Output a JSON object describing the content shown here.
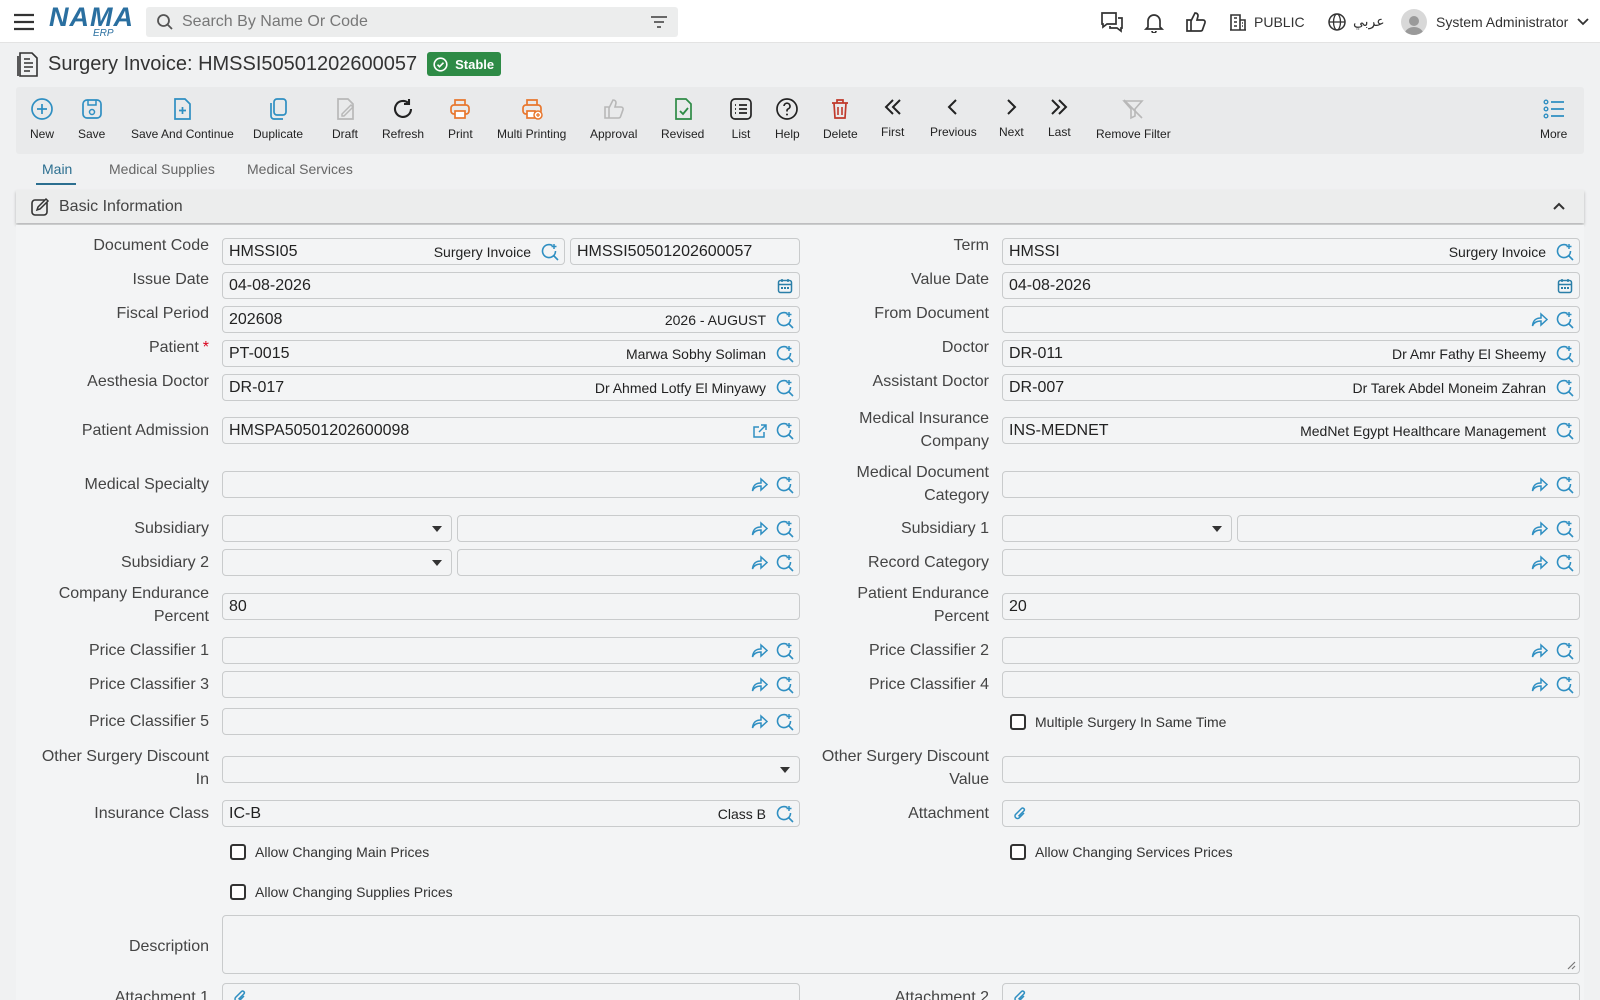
{
  "topbar": {
    "logo_main": "NAMA",
    "logo_sub": "ERP",
    "search_placeholder": "Search By Name Or Code",
    "company": "PUBLIC",
    "language": "عربي",
    "user": "System Administrator"
  },
  "page": {
    "title": "Surgery Invoice: HMSSI50501202600057",
    "status": "Stable"
  },
  "toolbar": {
    "new": "New",
    "save": "Save",
    "save_continue": "Save And Continue",
    "duplicate": "Duplicate",
    "draft": "Draft",
    "refresh": "Refresh",
    "print": "Print",
    "multi_printing": "Multi Printing",
    "approval": "Approval",
    "revised": "Revised",
    "list": "List",
    "help": "Help",
    "delete": "Delete",
    "first": "First",
    "previous": "Previous",
    "next": "Next",
    "last": "Last",
    "remove_filter": "Remove Filter",
    "more": "More"
  },
  "tabs": [
    "Main",
    "Medical Supplies",
    "Medical Services"
  ],
  "section": {
    "title": "Basic Information"
  },
  "form": {
    "document_code": {
      "label": "Document Code",
      "code": "HMSSI05",
      "desc": "Surgery Invoice",
      "number": "HMSSI50501202600057"
    },
    "term": {
      "label": "Term",
      "code": "HMSSI",
      "desc": "Surgery Invoice"
    },
    "issue_date": {
      "label": "Issue Date",
      "value": "04-08-2026"
    },
    "value_date": {
      "label": "Value Date",
      "value": "04-08-2026"
    },
    "fiscal_period": {
      "label": "Fiscal Period",
      "code": "202608",
      "desc": "2026 - AUGUST"
    },
    "from_document": {
      "label": "From Document",
      "value": ""
    },
    "patient": {
      "label": "Patient",
      "required": "*",
      "code": "PT-0015",
      "desc": "Marwa Sobhy Soliman"
    },
    "doctor": {
      "label": "Doctor",
      "code": "DR-011",
      "desc": "Dr Amr Fathy El Sheemy"
    },
    "aesthesia_doctor": {
      "label": "Aesthesia Doctor",
      "code": "DR-017",
      "desc": "Dr Ahmed Lotfy El Minyawy"
    },
    "assistant_doctor": {
      "label": "Assistant Doctor",
      "code": "DR-007",
      "desc": "Dr Tarek Abdel Moneim Zahran"
    },
    "patient_admission": {
      "label": "Patient Admission",
      "code": "HMSPA50501202600098"
    },
    "medical_insurance_company": {
      "label_1": "Medical Insurance",
      "label_2": "Company",
      "code": "INS-MEDNET",
      "desc": "MedNet Egypt Healthcare Management"
    },
    "medical_specialty": {
      "label": "Medical Specialty",
      "value": ""
    },
    "medical_document_category": {
      "label_1": "Medical Document",
      "label_2": "Category",
      "value": ""
    },
    "subsidiary": {
      "label": "Subsidiary"
    },
    "subsidiary_1": {
      "label": "Subsidiary 1"
    },
    "subsidiary_2": {
      "label": "Subsidiary 2"
    },
    "record_category": {
      "label": "Record Category"
    },
    "company_endurance_percent": {
      "label_1": "Company Endurance",
      "label_2": "Percent",
      "value": "80"
    },
    "patient_endurance_percent": {
      "label_1": "Patient Endurance",
      "label_2": "Percent",
      "value": "20"
    },
    "price_classifier_1": {
      "label": "Price Classifier 1"
    },
    "price_classifier_2": {
      "label": "Price Classifier 2"
    },
    "price_classifier_3": {
      "label": "Price Classifier 3"
    },
    "price_classifier_4": {
      "label": "Price Classifier 4"
    },
    "price_classifier_5": {
      "label": "Price Classifier 5"
    },
    "multiple_surgery": {
      "label": "Multiple Surgery In Same Time",
      "checked": false
    },
    "other_surgery_discount_in": {
      "label_1": "Other Surgery Discount",
      "label_2": "In",
      "value": ""
    },
    "other_surgery_discount_value": {
      "label_1": "Other Surgery Discount",
      "label_2": "Value",
      "value": ""
    },
    "insurance_class": {
      "label": "Insurance Class",
      "code": "IC-B",
      "desc": "Class B"
    },
    "attachment": {
      "label": "Attachment"
    },
    "allow_changing_main_prices": {
      "label": "Allow Changing Main Prices",
      "checked": false
    },
    "allow_changing_services_prices": {
      "label": "Allow Changing Services Prices",
      "checked": false
    },
    "allow_changing_supplies_prices": {
      "label": "Allow Changing Supplies Prices",
      "checked": false
    },
    "description": {
      "label": "Description",
      "value": ""
    },
    "attachment_1": {
      "label": "Attachment 1"
    },
    "attachment_2": {
      "label": "Attachment 2"
    }
  },
  "colors": {
    "accent": "#2c6f90",
    "link_icon": "#2f8fc2",
    "stable": "#2e8b46",
    "delete": "#c0392b",
    "print": "#e8772e",
    "revised": "#2e8b46"
  }
}
